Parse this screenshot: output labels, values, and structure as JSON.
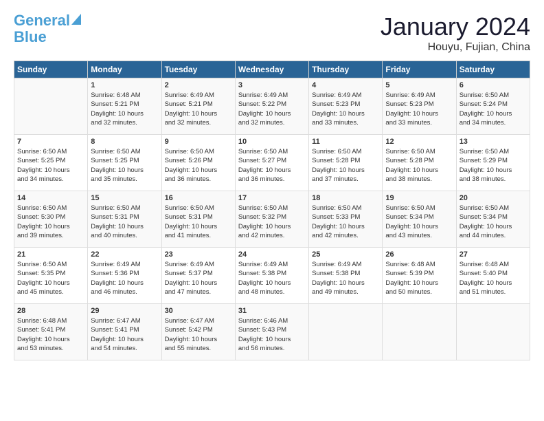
{
  "header": {
    "logo_line1": "General",
    "logo_line2": "Blue",
    "month_title": "January 2024",
    "location": "Houyu, Fujian, China"
  },
  "days_of_week": [
    "Sunday",
    "Monday",
    "Tuesday",
    "Wednesday",
    "Thursday",
    "Friday",
    "Saturday"
  ],
  "weeks": [
    [
      {
        "day": "",
        "sunrise": "",
        "sunset": "",
        "daylight": ""
      },
      {
        "day": "1",
        "sunrise": "Sunrise: 6:48 AM",
        "sunset": "Sunset: 5:21 PM",
        "daylight": "Daylight: 10 hours and 32 minutes."
      },
      {
        "day": "2",
        "sunrise": "Sunrise: 6:49 AM",
        "sunset": "Sunset: 5:21 PM",
        "daylight": "Daylight: 10 hours and 32 minutes."
      },
      {
        "day": "3",
        "sunrise": "Sunrise: 6:49 AM",
        "sunset": "Sunset: 5:22 PM",
        "daylight": "Daylight: 10 hours and 32 minutes."
      },
      {
        "day": "4",
        "sunrise": "Sunrise: 6:49 AM",
        "sunset": "Sunset: 5:23 PM",
        "daylight": "Daylight: 10 hours and 33 minutes."
      },
      {
        "day": "5",
        "sunrise": "Sunrise: 6:49 AM",
        "sunset": "Sunset: 5:23 PM",
        "daylight": "Daylight: 10 hours and 33 minutes."
      },
      {
        "day": "6",
        "sunrise": "Sunrise: 6:50 AM",
        "sunset": "Sunset: 5:24 PM",
        "daylight": "Daylight: 10 hours and 34 minutes."
      }
    ],
    [
      {
        "day": "7",
        "sunrise": "Sunrise: 6:50 AM",
        "sunset": "Sunset: 5:25 PM",
        "daylight": "Daylight: 10 hours and 34 minutes."
      },
      {
        "day": "8",
        "sunrise": "Sunrise: 6:50 AM",
        "sunset": "Sunset: 5:25 PM",
        "daylight": "Daylight: 10 hours and 35 minutes."
      },
      {
        "day": "9",
        "sunrise": "Sunrise: 6:50 AM",
        "sunset": "Sunset: 5:26 PM",
        "daylight": "Daylight: 10 hours and 36 minutes."
      },
      {
        "day": "10",
        "sunrise": "Sunrise: 6:50 AM",
        "sunset": "Sunset: 5:27 PM",
        "daylight": "Daylight: 10 hours and 36 minutes."
      },
      {
        "day": "11",
        "sunrise": "Sunrise: 6:50 AM",
        "sunset": "Sunset: 5:28 PM",
        "daylight": "Daylight: 10 hours and 37 minutes."
      },
      {
        "day": "12",
        "sunrise": "Sunrise: 6:50 AM",
        "sunset": "Sunset: 5:28 PM",
        "daylight": "Daylight: 10 hours and 38 minutes."
      },
      {
        "day": "13",
        "sunrise": "Sunrise: 6:50 AM",
        "sunset": "Sunset: 5:29 PM",
        "daylight": "Daylight: 10 hours and 38 minutes."
      }
    ],
    [
      {
        "day": "14",
        "sunrise": "Sunrise: 6:50 AM",
        "sunset": "Sunset: 5:30 PM",
        "daylight": "Daylight: 10 hours and 39 minutes."
      },
      {
        "day": "15",
        "sunrise": "Sunrise: 6:50 AM",
        "sunset": "Sunset: 5:31 PM",
        "daylight": "Daylight: 10 hours and 40 minutes."
      },
      {
        "day": "16",
        "sunrise": "Sunrise: 6:50 AM",
        "sunset": "Sunset: 5:31 PM",
        "daylight": "Daylight: 10 hours and 41 minutes."
      },
      {
        "day": "17",
        "sunrise": "Sunrise: 6:50 AM",
        "sunset": "Sunset: 5:32 PM",
        "daylight": "Daylight: 10 hours and 42 minutes."
      },
      {
        "day": "18",
        "sunrise": "Sunrise: 6:50 AM",
        "sunset": "Sunset: 5:33 PM",
        "daylight": "Daylight: 10 hours and 42 minutes."
      },
      {
        "day": "19",
        "sunrise": "Sunrise: 6:50 AM",
        "sunset": "Sunset: 5:34 PM",
        "daylight": "Daylight: 10 hours and 43 minutes."
      },
      {
        "day": "20",
        "sunrise": "Sunrise: 6:50 AM",
        "sunset": "Sunset: 5:34 PM",
        "daylight": "Daylight: 10 hours and 44 minutes."
      }
    ],
    [
      {
        "day": "21",
        "sunrise": "Sunrise: 6:50 AM",
        "sunset": "Sunset: 5:35 PM",
        "daylight": "Daylight: 10 hours and 45 minutes."
      },
      {
        "day": "22",
        "sunrise": "Sunrise: 6:49 AM",
        "sunset": "Sunset: 5:36 PM",
        "daylight": "Daylight: 10 hours and 46 minutes."
      },
      {
        "day": "23",
        "sunrise": "Sunrise: 6:49 AM",
        "sunset": "Sunset: 5:37 PM",
        "daylight": "Daylight: 10 hours and 47 minutes."
      },
      {
        "day": "24",
        "sunrise": "Sunrise: 6:49 AM",
        "sunset": "Sunset: 5:38 PM",
        "daylight": "Daylight: 10 hours and 48 minutes."
      },
      {
        "day": "25",
        "sunrise": "Sunrise: 6:49 AM",
        "sunset": "Sunset: 5:38 PM",
        "daylight": "Daylight: 10 hours and 49 minutes."
      },
      {
        "day": "26",
        "sunrise": "Sunrise: 6:48 AM",
        "sunset": "Sunset: 5:39 PM",
        "daylight": "Daylight: 10 hours and 50 minutes."
      },
      {
        "day": "27",
        "sunrise": "Sunrise: 6:48 AM",
        "sunset": "Sunset: 5:40 PM",
        "daylight": "Daylight: 10 hours and 51 minutes."
      }
    ],
    [
      {
        "day": "28",
        "sunrise": "Sunrise: 6:48 AM",
        "sunset": "Sunset: 5:41 PM",
        "daylight": "Daylight: 10 hours and 53 minutes."
      },
      {
        "day": "29",
        "sunrise": "Sunrise: 6:47 AM",
        "sunset": "Sunset: 5:41 PM",
        "daylight": "Daylight: 10 hours and 54 minutes."
      },
      {
        "day": "30",
        "sunrise": "Sunrise: 6:47 AM",
        "sunset": "Sunset: 5:42 PM",
        "daylight": "Daylight: 10 hours and 55 minutes."
      },
      {
        "day": "31",
        "sunrise": "Sunrise: 6:46 AM",
        "sunset": "Sunset: 5:43 PM",
        "daylight": "Daylight: 10 hours and 56 minutes."
      },
      {
        "day": "",
        "sunrise": "",
        "sunset": "",
        "daylight": ""
      },
      {
        "day": "",
        "sunrise": "",
        "sunset": "",
        "daylight": ""
      },
      {
        "day": "",
        "sunrise": "",
        "sunset": "",
        "daylight": ""
      }
    ]
  ]
}
